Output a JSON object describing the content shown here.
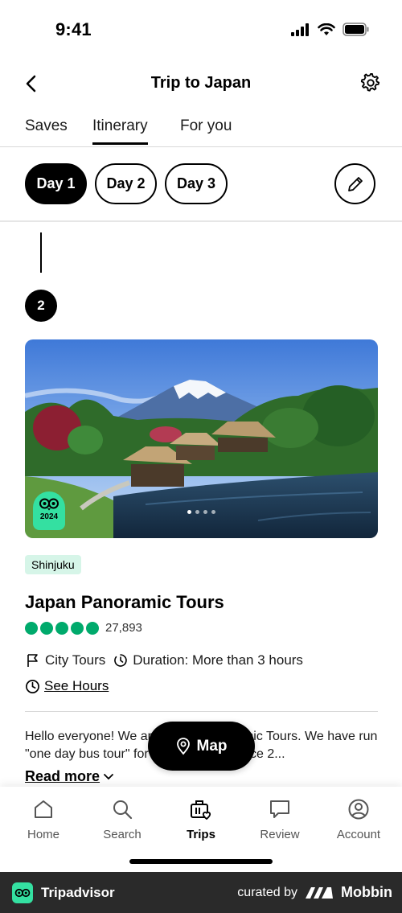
{
  "status": {
    "time": "9:41"
  },
  "header": {
    "title": "Trip to Japan"
  },
  "tabs": [
    {
      "label": "Saves",
      "active": false
    },
    {
      "label": "Itinerary",
      "active": true
    },
    {
      "label": "For you",
      "active": false
    }
  ],
  "days": [
    {
      "label": "Day 1",
      "active": true
    },
    {
      "label": "Day 2",
      "active": false
    },
    {
      "label": "Day 3",
      "active": false
    }
  ],
  "itinerary_item": {
    "step_number": "2",
    "award_year": "2024",
    "photo_count": 4,
    "photo_index": 1,
    "tag": "Shinjuku",
    "title": "Japan Panoramic Tours",
    "rating_bubbles": 5,
    "review_count": "27,893",
    "category": "City Tours",
    "duration": "Duration: More than 3 hours",
    "hours_link": "See Hours",
    "description": "Hello everyone! We are Japan Panoramic Tours. We have run \"one day bus tour\" for about 7 years since 2...",
    "read_more": "Read more"
  },
  "map_button": {
    "label": "Map"
  },
  "bottom_nav": [
    {
      "label": "Home",
      "icon": "home-icon",
      "active": false
    },
    {
      "label": "Search",
      "icon": "search-icon",
      "active": false
    },
    {
      "label": "Trips",
      "icon": "trips-icon",
      "active": true
    },
    {
      "label": "Review",
      "icon": "review-icon",
      "active": false
    },
    {
      "label": "Account",
      "icon": "account-icon",
      "active": false
    }
  ],
  "footer": {
    "brand": "Tripadvisor",
    "curated_by": "curated by",
    "partner": "Mobbin"
  },
  "colors": {
    "accent_green": "#00aa6c",
    "award_green": "#34e0a1",
    "tag_bg": "#d6f5e8"
  }
}
